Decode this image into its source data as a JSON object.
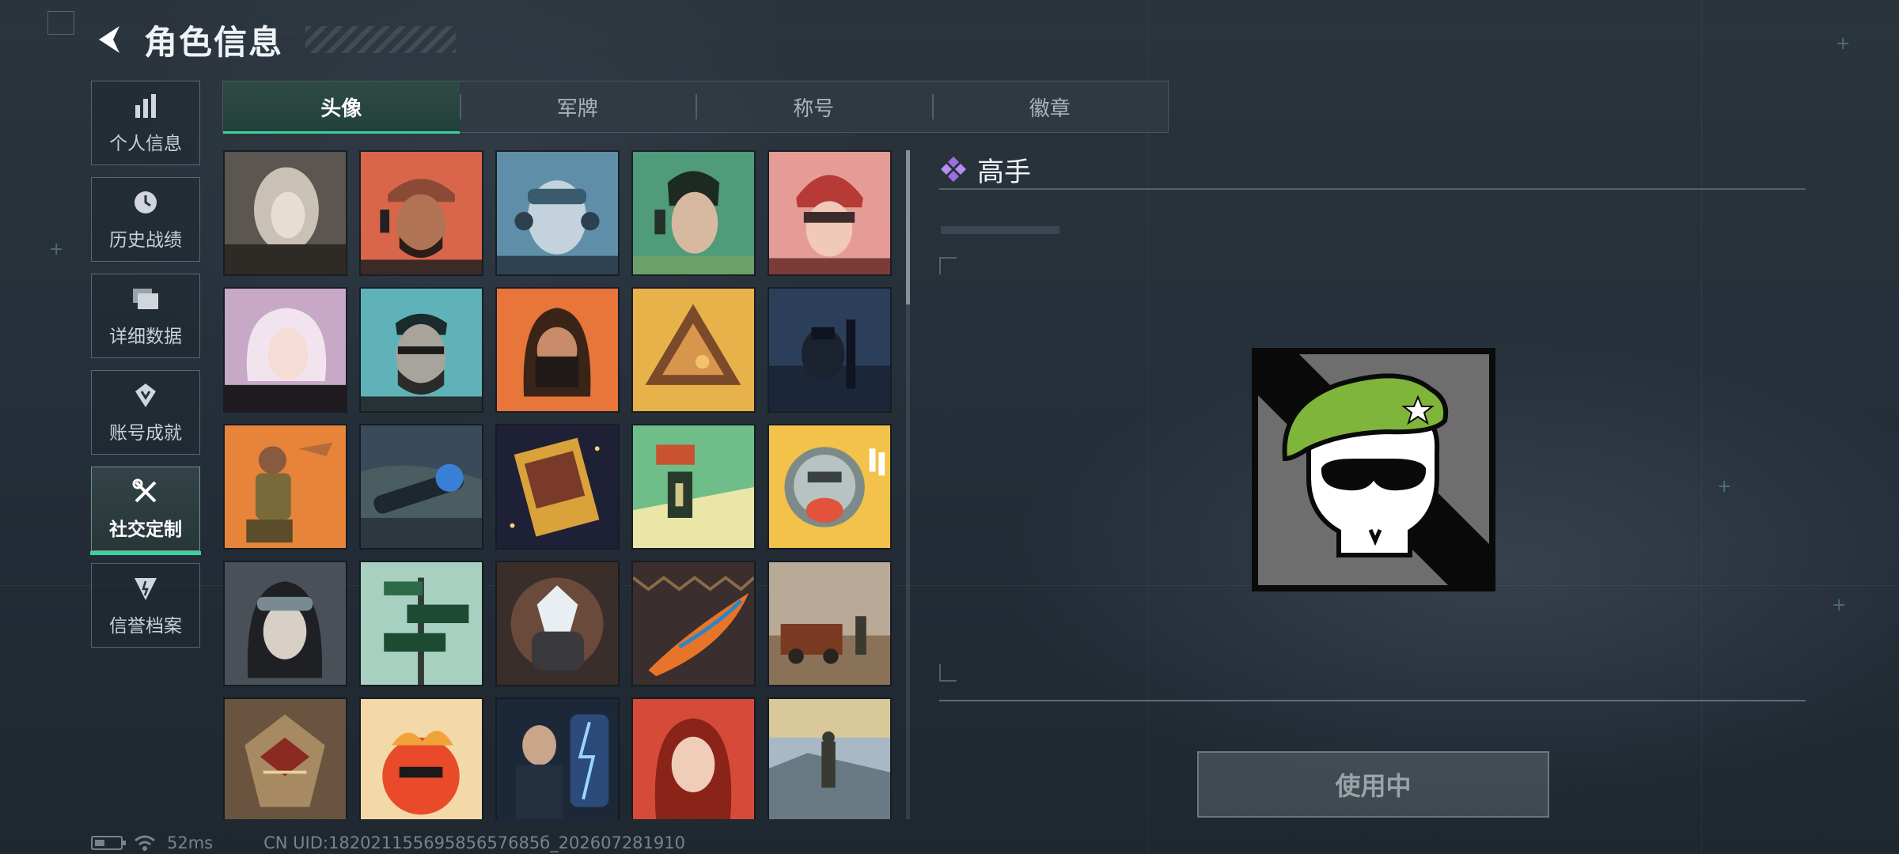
{
  "header": {
    "title": "角色信息"
  },
  "sidebar": {
    "items": [
      {
        "label": "个人信息",
        "icon": "bar-chart-icon"
      },
      {
        "label": "历史战绩",
        "icon": "history-clock-icon"
      },
      {
        "label": "详细数据",
        "icon": "folder-icon"
      },
      {
        "label": "账号成就",
        "icon": "achievement-icon"
      },
      {
        "label": "社交定制",
        "icon": "wrench-screwdriver-icon",
        "active": true
      },
      {
        "label": "信誉档案",
        "icon": "shield-emblem-icon"
      }
    ]
  },
  "tabs": [
    {
      "label": "头像",
      "active": true
    },
    {
      "label": "军牌"
    },
    {
      "label": "称号"
    },
    {
      "label": "徽章"
    }
  ],
  "avatars": [
    "white-haired-hooded-portrait",
    "bearded-cap-headset-soldier",
    "goggles-headset-pilot",
    "green-headset-soldier",
    "red-helmet-operator",
    "pink-hair-girl",
    "bearded-glasses-operator",
    "masked-longhair-fighter",
    "golden-triangle-emblem",
    "night-vision-soldier",
    "muscular-pilot-figure",
    "sniper-scope-rifle",
    "game-box-card",
    "exit-door-room",
    "cartoon-eating-soldier",
    "goggles-woman-portrait",
    "way-out-no-exit-signs",
    "crystal-fist",
    "feather-tribal-pattern",
    "rusty-truck-soldier",
    "scales-of-justice-emblem",
    "cool-fries-mascot",
    "lightning-tech-man",
    "red-hair-woman",
    "summit-soldier"
  ],
  "detail": {
    "rank_name": "高手",
    "rank_icon": "diamond-cluster-icon",
    "preview_icon": "green-beret-skull-icon",
    "colors": {
      "beret": "#7fb53a",
      "accent": "#3fd0a0",
      "rank_diamond": "#9b6fe0"
    }
  },
  "use_button": {
    "label": "使用中"
  },
  "status": {
    "ping": "52ms",
    "uid": "CN UID:18202115569585657685б_202607281910"
  }
}
